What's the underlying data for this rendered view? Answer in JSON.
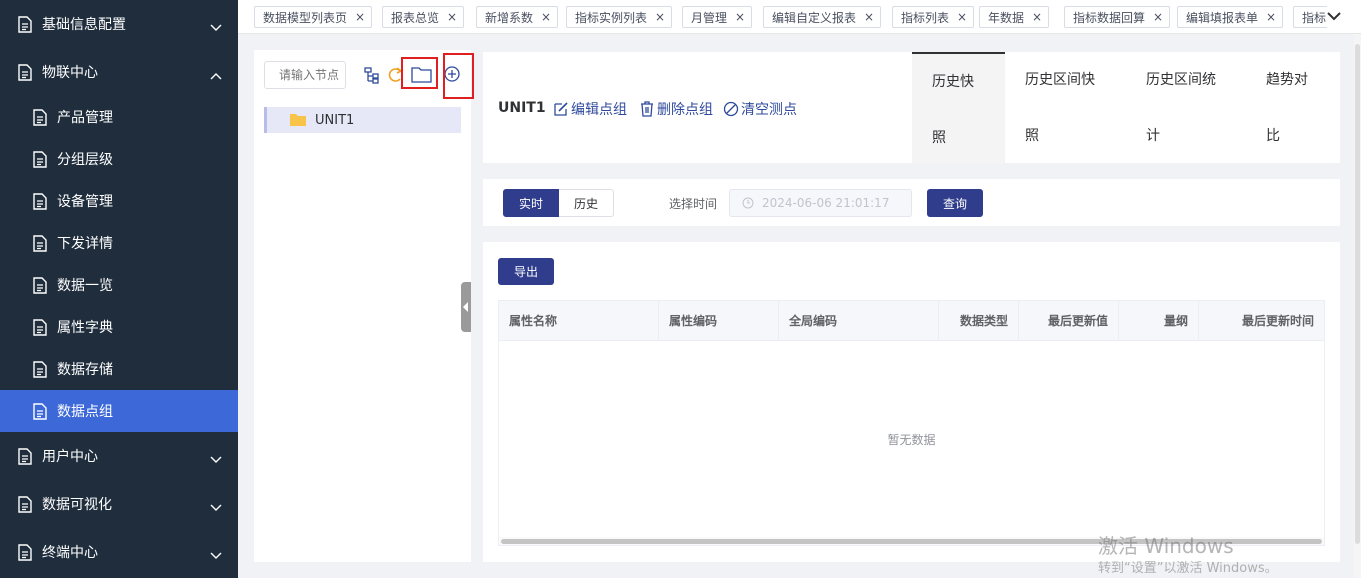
{
  "sidebar": {
    "items": [
      {
        "label": "基础信息配置",
        "type": "top",
        "expanded": false
      },
      {
        "label": "物联中心",
        "type": "top",
        "expanded": true
      },
      {
        "label": "产品管理",
        "type": "sub"
      },
      {
        "label": "分组层级",
        "type": "sub"
      },
      {
        "label": "设备管理",
        "type": "sub"
      },
      {
        "label": "下发详情",
        "type": "sub"
      },
      {
        "label": "数据一览",
        "type": "sub"
      },
      {
        "label": "属性字典",
        "type": "sub"
      },
      {
        "label": "数据存储",
        "type": "sub"
      },
      {
        "label": "数据点组",
        "type": "sub",
        "active": true
      },
      {
        "label": "用户中心",
        "type": "top",
        "expanded": false
      },
      {
        "label": "数据可视化",
        "type": "top",
        "expanded": false
      },
      {
        "label": "终端中心",
        "type": "top",
        "expanded": false
      }
    ]
  },
  "tags": [
    "数据模型列表页",
    "报表总览",
    "新增系数",
    "指标实例列表",
    "月管理",
    "编辑自定义报表",
    "指标列表",
    "年数据",
    "指标数据回算",
    "编辑填报表单",
    "指标"
  ],
  "tree": {
    "search_placeholder": "请输入节点",
    "nodes": [
      {
        "label": "UNIT1"
      }
    ]
  },
  "header": {
    "title": "UNIT1",
    "edit_label": "编辑点组",
    "delete_label": "删除点组",
    "clear_label": "清空测点",
    "tabs": [
      {
        "line1": "历史快",
        "line2": "照"
      },
      {
        "line1": "历史区间快",
        "line2": "照"
      },
      {
        "line1": "历史区间统",
        "line2": "计"
      },
      {
        "line1": "趋势对",
        "line2": "比"
      }
    ]
  },
  "query": {
    "realtime_label": "实时",
    "history_label": "历史",
    "time_label": "选择时间",
    "time_value": "2024-06-06 21:01:17",
    "search_label": "查询"
  },
  "table": {
    "export_label": "导出",
    "columns": [
      "属性名称",
      "属性编码",
      "全局编码",
      "数据类型",
      "最后更新值",
      "量纲",
      "最后更新时间"
    ],
    "empty_text": "暂无数据"
  },
  "watermark": {
    "line1": "激活 Windows",
    "line2": "转到“设置”以激活 Windows。"
  },
  "colors": {
    "sidebar_bg": "#1f2d3d",
    "active": "#3d68d8",
    "primary": "#2f3d8c",
    "highlight": "#e02020"
  }
}
